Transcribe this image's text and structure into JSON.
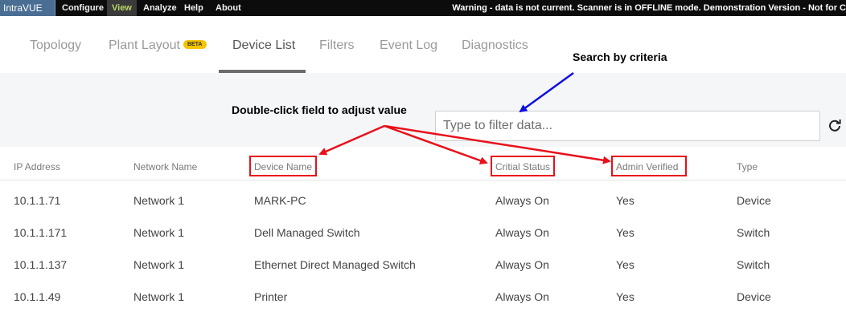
{
  "menubar": {
    "app_name": "IntraVUE",
    "items": [
      "Configure",
      "View",
      "Analyze",
      "Help",
      "About"
    ],
    "active_item": "View",
    "warning": "Warning - data is not current. Scanner is in OFFLINE mode. Demonstration Version - Not for C"
  },
  "tabs": {
    "items": [
      {
        "label": "Topology"
      },
      {
        "label": "Plant Layout",
        "badge": "BETA"
      },
      {
        "label": "Device List",
        "active": true
      },
      {
        "label": "Filters"
      },
      {
        "label": "Event Log"
      },
      {
        "label": "Diagnostics"
      }
    ]
  },
  "filter": {
    "placeholder": "Type to filter data...",
    "refresh_icon": "refresh-icon"
  },
  "table": {
    "columns": [
      "IP Address",
      "Network Name",
      "Device Name",
      "Critial Status",
      "Admin Verified",
      "Type"
    ],
    "rows": [
      [
        "10.1.1.71",
        "Network 1",
        "MARK-PC",
        "Always On",
        "Yes",
        "Device"
      ],
      [
        "10.1.1.171",
        "Network 1",
        "Dell Managed Switch",
        "Always On",
        "Yes",
        "Switch"
      ],
      [
        "10.1.1.137",
        "Network 1",
        "Ethernet Direct Managed Switch",
        "Always On",
        "Yes",
        "Switch"
      ],
      [
        "10.1.1.49",
        "Network 1",
        "Printer",
        "Always On",
        "Yes",
        "Device"
      ]
    ]
  },
  "annotations": {
    "search": "Search by criteria",
    "double_click": "Double-click field to adjust value",
    "highlight_color": "#e8101a",
    "search_arrow_color": "#1010e0"
  }
}
